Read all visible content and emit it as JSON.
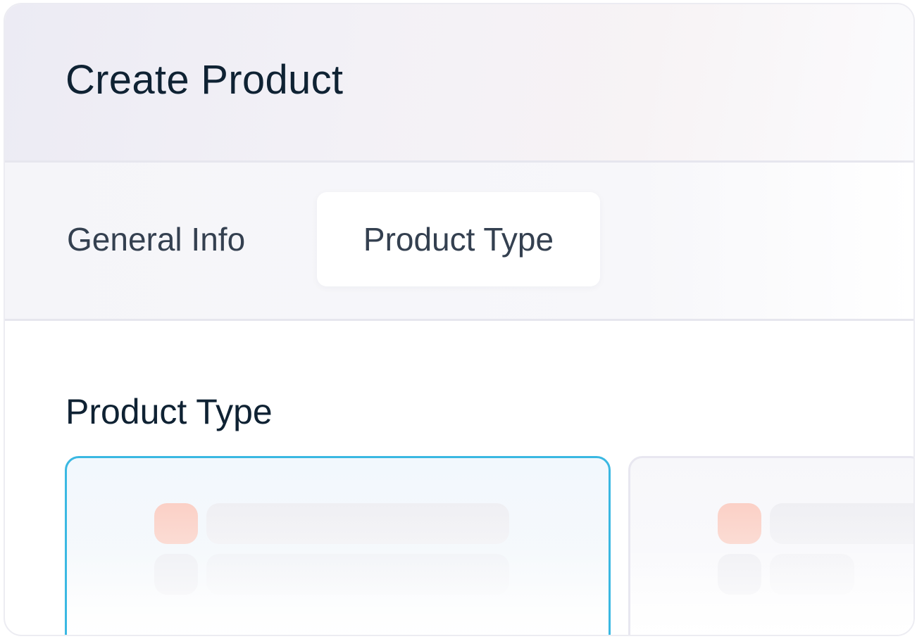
{
  "header": {
    "title": "Create Product"
  },
  "tabs": [
    {
      "label": "General Info",
      "active": false
    },
    {
      "label": "Product Type",
      "active": true
    }
  ],
  "section": {
    "title": "Product Type"
  },
  "type_cards": [
    {
      "selected": true,
      "accent": "#3ab8e2"
    },
    {
      "selected": false,
      "accent": "#e8e7f0"
    }
  ],
  "colors": {
    "title_text": "#0f2233",
    "tab_text": "#344050",
    "selected_border": "#3ab8e2",
    "placeholder_icon": "#fbd0c6"
  }
}
